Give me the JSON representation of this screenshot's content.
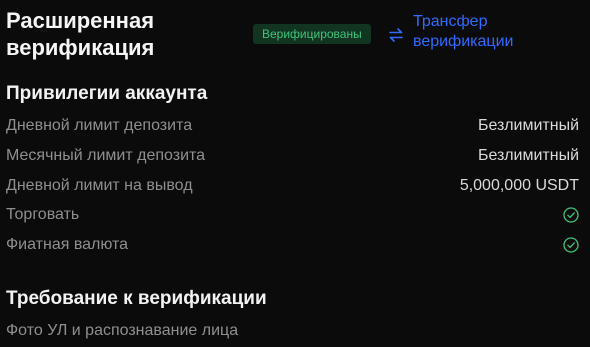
{
  "header": {
    "title": "Расширенная\nверификация",
    "badge": "Верифицированы",
    "transfer_label": "Трансфер\nверификации",
    "accent_color": "#2f6bff",
    "badge_color": "#3ec47a"
  },
  "privileges": {
    "title": "Привилегии аккаунта",
    "rows": [
      {
        "label": "Дневной лимит депозита",
        "value": "Безлимитный"
      },
      {
        "label": "Месячный лимит депозита",
        "value": "Безлимитный"
      },
      {
        "label": "Дневной лимит на вывод",
        "value": "5,000,000 USDT"
      },
      {
        "label": "Торговать",
        "icon": "check-circle-icon"
      },
      {
        "label": "Фиатная валюта",
        "icon": "check-circle-icon"
      }
    ]
  },
  "requirements": {
    "title": "Требование к верификации",
    "items": [
      "Фото УЛ и распознавание лица"
    ]
  }
}
